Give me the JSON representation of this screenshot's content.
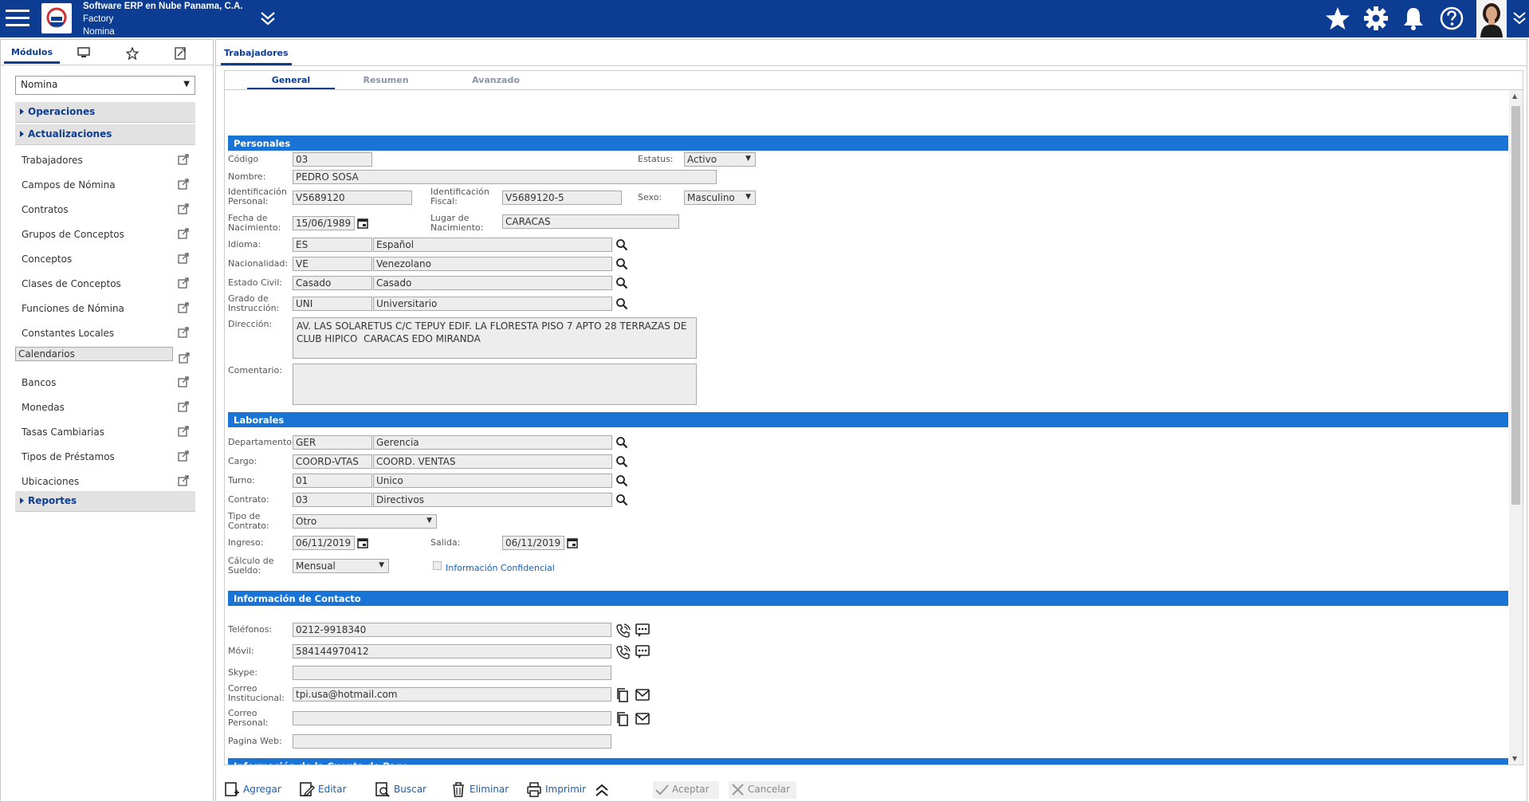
{
  "header": {
    "company": "Software ERP en Nube Panama, C.A.",
    "context": "Factory",
    "module": "Nomina"
  },
  "left_panel": {
    "tabs": [
      "Módulos"
    ],
    "module_select": "Nomina",
    "groups": {
      "operaciones": "Operaciones",
      "actualizaciones": "Actualizaciones",
      "reportes": "Reportes"
    },
    "items": [
      "Trabajadores",
      "Campos de Nómina",
      "Contratos",
      "Grupos de Conceptos",
      "Conceptos",
      "Clases de Conceptos",
      "Funciones de Nómina",
      "Constantes Locales",
      "Calendarios",
      "Bancos",
      "Monedas",
      "Tasas Cambiarias",
      "Tipos de Préstamos",
      "Ubicaciones"
    ],
    "selected_item": "Calendarios"
  },
  "main": {
    "tab": "Trabajadores",
    "sub_tabs": [
      "General",
      "Resumen",
      "Avanzado"
    ],
    "active_sub_tab": "General",
    "sections": {
      "personales": "Personales",
      "laborales": "Laborales",
      "contacto": "Información de Contacto",
      "cuenta_pago": "Información de la Cuenta de Pago"
    },
    "personales": {
      "codigo_label": "Código",
      "codigo": "03",
      "estatus_label": "Estatus:",
      "estatus": "Activo",
      "nombre_label": "Nombre:",
      "nombre": "PEDRO SOSA",
      "id_personal_label_1": "Identificación",
      "id_personal_label_2": "Personal:",
      "id_personal": "V5689120",
      "id_fiscal_label_1": "Identificación",
      "id_fiscal_label_2": "Fiscal:",
      "id_fiscal": "V5689120-5",
      "sexo_label": "Sexo:",
      "sexo": "Masculino",
      "fecha_nac_label_1": "Fecha de",
      "fecha_nac_label_2": "Nacimiento:",
      "fecha_nac": "15/06/1989",
      "lugar_nac_label_1": "Lugar de",
      "lugar_nac_label_2": "Nacimiento:",
      "lugar_nac": "CARACAS",
      "idioma_label": "Idioma:",
      "idioma_code": "ES",
      "idioma_name": "Español",
      "nacionalidad_label": "Nacionalidad:",
      "nacionalidad_code": "VE",
      "nacionalidad_name": "Venezolano",
      "estado_civil_label": "Estado Civil:",
      "estado_civil_code": "Casado",
      "estado_civil_name": "Casado",
      "grado_label_1": "Grado de",
      "grado_label_2": "Instrucción:",
      "grado_code": "UNI",
      "grado_name": "Universitario",
      "direccion_label": "Dirección:",
      "direccion": "AV. LAS SOLARETUS C/C TEPUY EDIF. LA FLORESTA PISO 7 APTO 28 TERRAZAS DE CLUB HIPICO  CARACAS EDO MIRANDA",
      "comentario_label": "Comentario:",
      "comentario": ""
    },
    "laborales": {
      "departamento_label": "Departamento:",
      "departamento_code": "GER",
      "departamento_name": "Gerencia",
      "cargo_label": "Cargo:",
      "cargo_code": "COORD-VTAS",
      "cargo_name": "COORD. VENTAS",
      "turno_label": "Turno:",
      "turno_code": "01",
      "turno_name": "Unico",
      "contrato_label": "Contrato:",
      "contrato_code": "03",
      "contrato_name": "Directivos",
      "tipo_contrato_label_1": "Tipo de",
      "tipo_contrato_label_2": "Contrato:",
      "tipo_contrato": "Otro",
      "ingreso_label": "Ingreso:",
      "ingreso": "06/11/2019",
      "salida_label": "Salida:",
      "salida": "06/11/2019",
      "calculo_label_1": "Cálculo de",
      "calculo_label_2": "Sueldo:",
      "calculo": "Mensual",
      "info_confidencial_label": "Información Confidencial",
      "info_confidencial": false
    },
    "contacto": {
      "telefonos_label": "Teléfonos:",
      "telefonos": "0212-9918340",
      "movil_label": "Móvil:",
      "movil": "584144970412",
      "skype_label": "Skype:",
      "skype": "",
      "correo_inst_label_1": "Correo",
      "correo_inst_label_2": "Institucional:",
      "correo_inst": "tpi.usa@hotmail.com",
      "correo_pers_label_1": "Correo",
      "correo_pers_label_2": "Personal:",
      "correo_pers": "",
      "web_label": "Pagina Web:",
      "web": ""
    }
  },
  "toolbar": {
    "agregar": "Agregar",
    "editar": "Editar",
    "buscar": "Buscar",
    "eliminar": "Eliminar",
    "imprimir": "Imprimir",
    "aceptar": "Aceptar",
    "cancelar": "Cancelar"
  },
  "colors": {
    "topbar": "#0d3d93",
    "section_header": "#1a74d6",
    "link": "#1a5fb4"
  }
}
